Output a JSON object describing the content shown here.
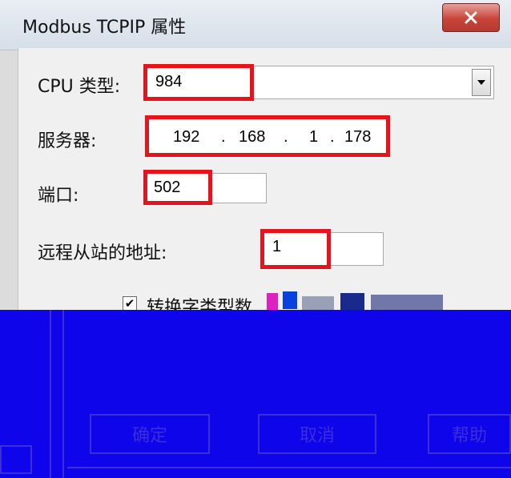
{
  "window": {
    "title": "Modbus TCPIP 属性",
    "close_glyph": "X"
  },
  "form": {
    "cpu_type": {
      "label": "CPU 类型:",
      "value": "984"
    },
    "server": {
      "label": "服务器:",
      "ip": [
        "192",
        "168",
        "1",
        "178"
      ],
      "separator": "."
    },
    "port": {
      "label": "端口:",
      "value": "502"
    },
    "remote_station": {
      "label": "远程从站的地址:",
      "value": "1"
    },
    "convert_checkbox": {
      "label": "转换字类型数",
      "checked": true,
      "check_glyph": "✔"
    }
  },
  "buttons": {
    "ok": "确定",
    "cancel": "取消",
    "help": "帮助"
  },
  "icons": {
    "dropdown": "chevron-down-icon",
    "close": "close-icon",
    "check": "check-icon"
  },
  "colors": {
    "highlight": "#e5141b",
    "cover": "#0e05ea",
    "cover_lines": "#3a2fd8"
  }
}
